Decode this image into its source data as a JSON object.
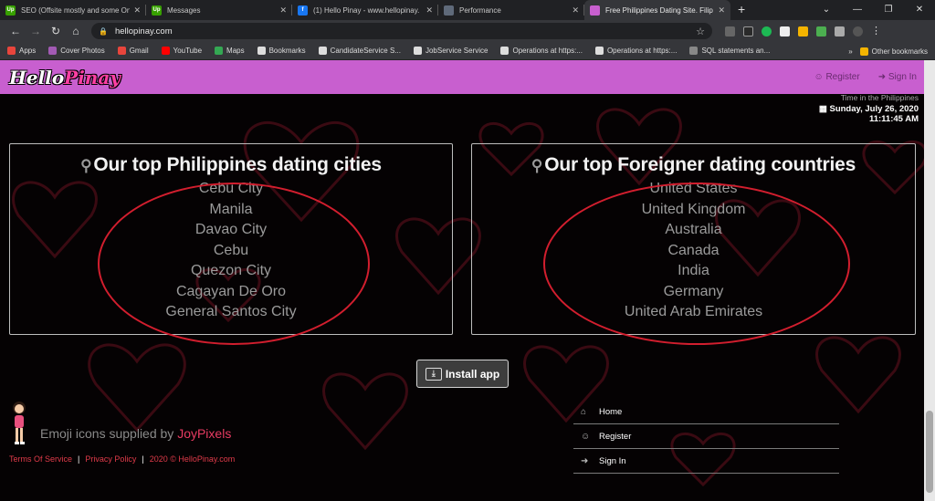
{
  "browser": {
    "tabs": [
      {
        "title": "SEO (Offsite mostly and some On",
        "favicon": "upwork-icon",
        "color": "#37a000",
        "letters": "Up"
      },
      {
        "title": "Messages",
        "favicon": "upwork-icon",
        "color": "#37a000",
        "letters": "Up"
      },
      {
        "title": "(1) Hello Pinay - www.hellopinay.",
        "favicon": "facebook-icon",
        "color": "#1877f2",
        "letters": "f"
      },
      {
        "title": "Performance",
        "favicon": "performance-icon",
        "color": "#5f6a7a",
        "letters": ""
      },
      {
        "title": "Free Philippines Dating Site. Filip",
        "favicon": "hellopinay-icon",
        "color": "#c85fcf",
        "letters": "",
        "active": true
      }
    ],
    "url": "hellopinay.com",
    "bookmarks": [
      {
        "label": "Apps",
        "icon": "apps-icon",
        "color": "#e8453c"
      },
      {
        "label": "Cover Photos",
        "icon": "cover-photos-icon",
        "color": "#a25ab4"
      },
      {
        "label": "Gmail",
        "icon": "gmail-icon",
        "color": "#e8453c"
      },
      {
        "label": "YouTube",
        "icon": "youtube-icon",
        "color": "#ff0000"
      },
      {
        "label": "Maps",
        "icon": "maps-icon",
        "color": "#34a853"
      },
      {
        "label": "Bookmarks",
        "icon": "star-icon",
        "color": "#dddddd"
      },
      {
        "label": "CandidateService S...",
        "icon": "globe-icon",
        "color": "#dddddd"
      },
      {
        "label": "JobService Service",
        "icon": "globe-icon",
        "color": "#dddddd"
      },
      {
        "label": "Operations at https:...",
        "icon": "globe-icon",
        "color": "#dddddd"
      },
      {
        "label": "Operations at https:...",
        "icon": "globe-icon",
        "color": "#dddddd"
      },
      {
        "label": "SQL statements an...",
        "icon": "github-icon",
        "color": "#888888"
      }
    ],
    "more": "»",
    "other_bookmarks": "Other bookmarks"
  },
  "header": {
    "logo_hello": "Hello",
    "logo_pinay": "Pinay",
    "register": "Register",
    "sign_in": "Sign In"
  },
  "time": {
    "label": "Time in the Philippines",
    "date": "Sunday, July 26, 2020",
    "clock": "11:11:45 AM"
  },
  "cities": {
    "title": "Our top Philippines dating cities",
    "items": [
      "Cebu City",
      "Manila",
      "Davao City",
      "Cebu",
      "Quezon City",
      "Cagayan De Oro",
      "General Santos City"
    ]
  },
  "countries": {
    "title": "Our top Foreigner dating countries",
    "items": [
      "United States",
      "United Kingdom",
      "Australia",
      "Canada",
      "India",
      "Germany",
      "United Arab Emirates"
    ]
  },
  "install": "Install app",
  "footer": {
    "emoji_prefix": "Emoji icons supplied by ",
    "emoji_link": "JoyPixels",
    "terms": "Terms Of Service",
    "privacy": "Privacy Policy",
    "copyright": "2020 © HelloPinay.com",
    "nav": [
      {
        "label": "Home",
        "icon": "home-icon"
      },
      {
        "label": "Register",
        "icon": "smiley-icon"
      },
      {
        "label": "Sign In",
        "icon": "sign-in-icon"
      }
    ]
  },
  "colors": {
    "header_bg": "#c85fcf",
    "annotation_oval": "#d21e2e",
    "link_red": "#e13b4a"
  }
}
